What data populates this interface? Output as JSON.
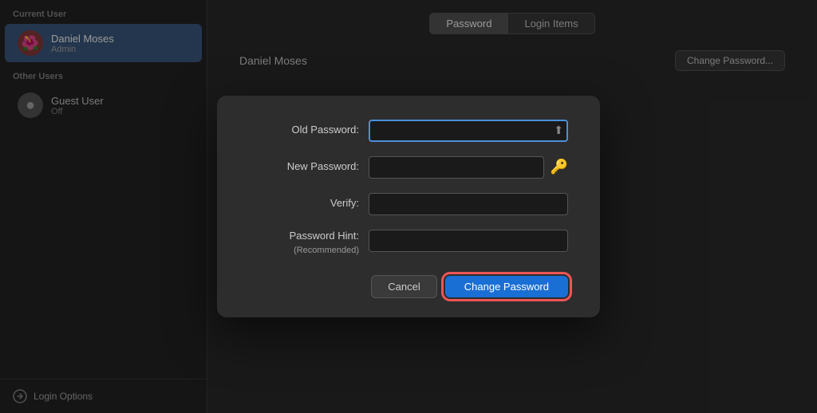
{
  "sidebar": {
    "current_user_label": "Current User",
    "other_users_label": "Other Users",
    "current_user": {
      "name": "Daniel Moses",
      "role": "Admin",
      "avatar_icon": "🌺"
    },
    "guest_user": {
      "name": "Guest User",
      "role": "Off",
      "avatar_icon": "👤"
    },
    "login_options_label": "Login Options"
  },
  "tabs": {
    "password_label": "Password",
    "login_items_label": "Login Items",
    "active": "password"
  },
  "user_header": {
    "username": "Daniel Moses",
    "change_password_button": "Change Password..."
  },
  "dialog": {
    "old_password_label": "Old Password:",
    "new_password_label": "New Password:",
    "verify_label": "Verify:",
    "password_hint_label": "Password Hint:",
    "recommended_label": "(Recommended)",
    "cancel_button": "Cancel",
    "change_password_button": "Change Password",
    "old_password_value": "",
    "new_password_value": "",
    "verify_value": "",
    "hint_value": ""
  }
}
